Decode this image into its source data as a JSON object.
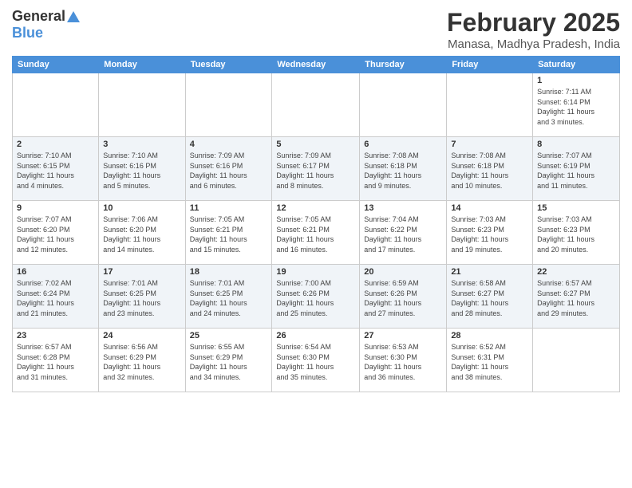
{
  "logo": {
    "general": "General",
    "blue": "Blue"
  },
  "header": {
    "month_year": "February 2025",
    "location": "Manasa, Madhya Pradesh, India"
  },
  "days_of_week": [
    "Sunday",
    "Monday",
    "Tuesday",
    "Wednesday",
    "Thursday",
    "Friday",
    "Saturday"
  ],
  "weeks": [
    [
      {
        "day": "",
        "info": ""
      },
      {
        "day": "",
        "info": ""
      },
      {
        "day": "",
        "info": ""
      },
      {
        "day": "",
        "info": ""
      },
      {
        "day": "",
        "info": ""
      },
      {
        "day": "",
        "info": ""
      },
      {
        "day": "1",
        "info": "Sunrise: 7:11 AM\nSunset: 6:14 PM\nDaylight: 11 hours\nand 3 minutes."
      }
    ],
    [
      {
        "day": "2",
        "info": "Sunrise: 7:10 AM\nSunset: 6:15 PM\nDaylight: 11 hours\nand 4 minutes."
      },
      {
        "day": "3",
        "info": "Sunrise: 7:10 AM\nSunset: 6:16 PM\nDaylight: 11 hours\nand 5 minutes."
      },
      {
        "day": "4",
        "info": "Sunrise: 7:09 AM\nSunset: 6:16 PM\nDaylight: 11 hours\nand 6 minutes."
      },
      {
        "day": "5",
        "info": "Sunrise: 7:09 AM\nSunset: 6:17 PM\nDaylight: 11 hours\nand 8 minutes."
      },
      {
        "day": "6",
        "info": "Sunrise: 7:08 AM\nSunset: 6:18 PM\nDaylight: 11 hours\nand 9 minutes."
      },
      {
        "day": "7",
        "info": "Sunrise: 7:08 AM\nSunset: 6:18 PM\nDaylight: 11 hours\nand 10 minutes."
      },
      {
        "day": "8",
        "info": "Sunrise: 7:07 AM\nSunset: 6:19 PM\nDaylight: 11 hours\nand 11 minutes."
      }
    ],
    [
      {
        "day": "9",
        "info": "Sunrise: 7:07 AM\nSunset: 6:20 PM\nDaylight: 11 hours\nand 12 minutes."
      },
      {
        "day": "10",
        "info": "Sunrise: 7:06 AM\nSunset: 6:20 PM\nDaylight: 11 hours\nand 14 minutes."
      },
      {
        "day": "11",
        "info": "Sunrise: 7:05 AM\nSunset: 6:21 PM\nDaylight: 11 hours\nand 15 minutes."
      },
      {
        "day": "12",
        "info": "Sunrise: 7:05 AM\nSunset: 6:21 PM\nDaylight: 11 hours\nand 16 minutes."
      },
      {
        "day": "13",
        "info": "Sunrise: 7:04 AM\nSunset: 6:22 PM\nDaylight: 11 hours\nand 17 minutes."
      },
      {
        "day": "14",
        "info": "Sunrise: 7:03 AM\nSunset: 6:23 PM\nDaylight: 11 hours\nand 19 minutes."
      },
      {
        "day": "15",
        "info": "Sunrise: 7:03 AM\nSunset: 6:23 PM\nDaylight: 11 hours\nand 20 minutes."
      }
    ],
    [
      {
        "day": "16",
        "info": "Sunrise: 7:02 AM\nSunset: 6:24 PM\nDaylight: 11 hours\nand 21 minutes."
      },
      {
        "day": "17",
        "info": "Sunrise: 7:01 AM\nSunset: 6:25 PM\nDaylight: 11 hours\nand 23 minutes."
      },
      {
        "day": "18",
        "info": "Sunrise: 7:01 AM\nSunset: 6:25 PM\nDaylight: 11 hours\nand 24 minutes."
      },
      {
        "day": "19",
        "info": "Sunrise: 7:00 AM\nSunset: 6:26 PM\nDaylight: 11 hours\nand 25 minutes."
      },
      {
        "day": "20",
        "info": "Sunrise: 6:59 AM\nSunset: 6:26 PM\nDaylight: 11 hours\nand 27 minutes."
      },
      {
        "day": "21",
        "info": "Sunrise: 6:58 AM\nSunset: 6:27 PM\nDaylight: 11 hours\nand 28 minutes."
      },
      {
        "day": "22",
        "info": "Sunrise: 6:57 AM\nSunset: 6:27 PM\nDaylight: 11 hours\nand 29 minutes."
      }
    ],
    [
      {
        "day": "23",
        "info": "Sunrise: 6:57 AM\nSunset: 6:28 PM\nDaylight: 11 hours\nand 31 minutes."
      },
      {
        "day": "24",
        "info": "Sunrise: 6:56 AM\nSunset: 6:29 PM\nDaylight: 11 hours\nand 32 minutes."
      },
      {
        "day": "25",
        "info": "Sunrise: 6:55 AM\nSunset: 6:29 PM\nDaylight: 11 hours\nand 34 minutes."
      },
      {
        "day": "26",
        "info": "Sunrise: 6:54 AM\nSunset: 6:30 PM\nDaylight: 11 hours\nand 35 minutes."
      },
      {
        "day": "27",
        "info": "Sunrise: 6:53 AM\nSunset: 6:30 PM\nDaylight: 11 hours\nand 36 minutes."
      },
      {
        "day": "28",
        "info": "Sunrise: 6:52 AM\nSunset: 6:31 PM\nDaylight: 11 hours\nand 38 minutes."
      },
      {
        "day": "",
        "info": ""
      }
    ]
  ]
}
